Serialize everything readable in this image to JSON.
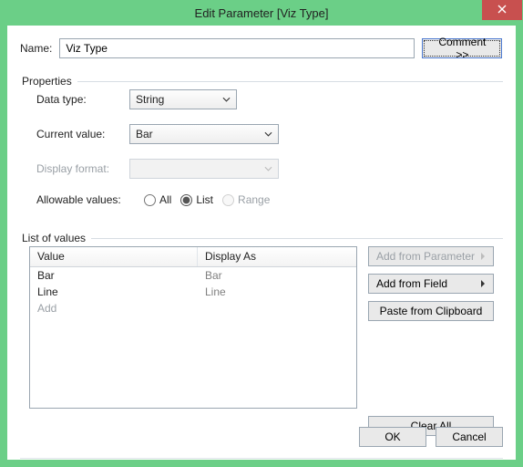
{
  "window": {
    "title": "Edit Parameter [Viz Type]",
    "close_icon": "close"
  },
  "name_row": {
    "label": "Name:",
    "value": "Viz Type",
    "comment_btn": "Comment >>"
  },
  "properties": {
    "legend": "Properties",
    "data_type": {
      "label": "Data type:",
      "value": "String"
    },
    "current_value": {
      "label": "Current value:",
      "value": "Bar"
    },
    "display_format": {
      "label": "Display format:",
      "value": ""
    },
    "allowable": {
      "label": "Allowable values:",
      "options": {
        "all": "All",
        "list": "List",
        "range": "Range"
      },
      "selected": "list"
    }
  },
  "list_of_values": {
    "legend": "List of values",
    "columns": {
      "value": "Value",
      "display_as": "Display As"
    },
    "rows": [
      {
        "value": "Bar",
        "display_as": "Bar"
      },
      {
        "value": "Line",
        "display_as": "Line"
      }
    ],
    "add_placeholder": "Add",
    "side": {
      "add_param": "Add from Parameter",
      "add_field": "Add from Field",
      "paste": "Paste from Clipboard",
      "clear": "Clear All"
    }
  },
  "footer": {
    "ok": "OK",
    "cancel": "Cancel"
  }
}
